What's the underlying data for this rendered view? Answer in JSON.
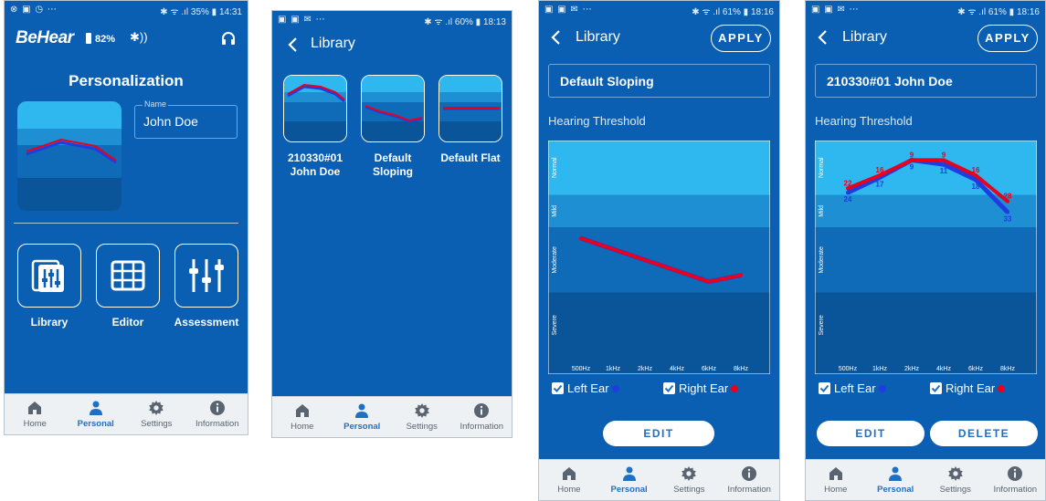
{
  "screens": {
    "home": {
      "status_left": "⊗ ▣ ◷ ⋯",
      "status_right": "✱ ᯤ .ıl 35% ▮ 14:31",
      "brand": "BeHear",
      "battery": "82%",
      "title": "Personalization",
      "name_label": "Name",
      "name_value": "John Doe",
      "tools": [
        {
          "label": "Library",
          "icon": "library-icon"
        },
        {
          "label": "Editor",
          "icon": "grid-icon"
        },
        {
          "label": "Assessment",
          "icon": "sliders-icon"
        }
      ]
    },
    "library_list": {
      "status_left": "▣ ▣ ✉ ⋯",
      "status_right": "✱ ᯤ .ıl 60% ▮ 18:13",
      "title": "Library",
      "cards": [
        {
          "name": "210330#01 John Doe",
          "line1": "210330#01",
          "line2": "John Doe"
        },
        {
          "name": "Default Sloping",
          "line1": "Default",
          "line2": "Sloping"
        },
        {
          "name": "Default Flat",
          "line1": "Default Flat",
          "line2": ""
        }
      ]
    },
    "detail_sloping": {
      "status_left": "▣ ▣ ✉ ⋯",
      "status_right": "✱ ᯤ .ıl 61% ▮ 18:16",
      "title": "Library",
      "apply": "APPLY",
      "profile_name": "Default Sloping",
      "section": "Hearing Threshold",
      "left_ear": "Left Ear",
      "right_ear": "Right Ear",
      "edit": "EDIT"
    },
    "detail_john": {
      "status_left": "▣ ▣ ✉ ⋯",
      "status_right": "✱ ᯤ .ıl 61% ▮ 18:16",
      "title": "Library",
      "apply": "APPLY",
      "profile_name": "210330#01 John Doe",
      "section": "Hearing Threshold",
      "left_ear": "Left Ear",
      "right_ear": "Right Ear",
      "edit": "EDIT",
      "delete": "DELETE"
    }
  },
  "nav": [
    {
      "label": "Home",
      "icon": "home-icon"
    },
    {
      "label": "Personal",
      "icon": "person-icon"
    },
    {
      "label": "Settings",
      "icon": "gear-icon"
    },
    {
      "label": "Information",
      "icon": "info-icon"
    }
  ],
  "colors": {
    "background": "#0a5fb2",
    "band_normal": "#2eb8ef",
    "band_mild": "#1d8fd2",
    "band_moderate": "#0f6bb7",
    "band_severe": "#0a559a",
    "left_ear": "#1f3ce0",
    "right_ear": "#e8001c",
    "nav_active": "#1f6fc2"
  },
  "chart_data": [
    {
      "type": "line",
      "title": "",
      "bands": [
        "Normal",
        "Mild",
        "Moderate",
        "Severe"
      ],
      "band_ranges": [
        [
          0,
          25
        ],
        [
          25,
          40
        ],
        [
          40,
          70
        ],
        [
          70,
          100
        ]
      ],
      "x": [
        "500Hz",
        "1kHz",
        "2kHz",
        "4kHz",
        "6kHz",
        "8kHz"
      ],
      "ylim": [
        0,
        100
      ],
      "y_inverted": true,
      "series": [
        {
          "name": "Left Ear",
          "color": "#1f3ce0",
          "values": [
            45,
            50,
            55,
            60,
            65,
            62
          ],
          "labels": [
            "",
            "",
            "",
            "",
            "",
            ""
          ]
        },
        {
          "name": "Right Ear",
          "color": "#e8001c",
          "values": [
            45,
            50,
            55,
            60,
            65,
            62
          ],
          "labels": [
            "",
            "",
            "",
            "",
            "",
            ""
          ]
        }
      ]
    },
    {
      "type": "line",
      "title": "",
      "bands": [
        "Normal",
        "Mild",
        "Moderate",
        "Severe"
      ],
      "band_ranges": [
        [
          0,
          25
        ],
        [
          25,
          40
        ],
        [
          40,
          70
        ],
        [
          70,
          100
        ]
      ],
      "x": [
        "500Hz",
        "1kHz",
        "2kHz",
        "4kHz",
        "6kHz",
        "8kHz"
      ],
      "ylim": [
        0,
        100
      ],
      "y_inverted": true,
      "series": [
        {
          "name": "Left Ear",
          "color": "#1f3ce0",
          "values": [
            24,
            17,
            9,
            11,
            18,
            33
          ],
          "labels": [
            "24",
            "17",
            "9",
            "11",
            "18",
            "33"
          ]
        },
        {
          "name": "Right Ear",
          "color": "#e8001c",
          "values": [
            22,
            16,
            9,
            9,
            16,
            28
          ],
          "labels": [
            "22",
            "16",
            "9",
            "9",
            "16",
            "28"
          ]
        }
      ]
    }
  ]
}
